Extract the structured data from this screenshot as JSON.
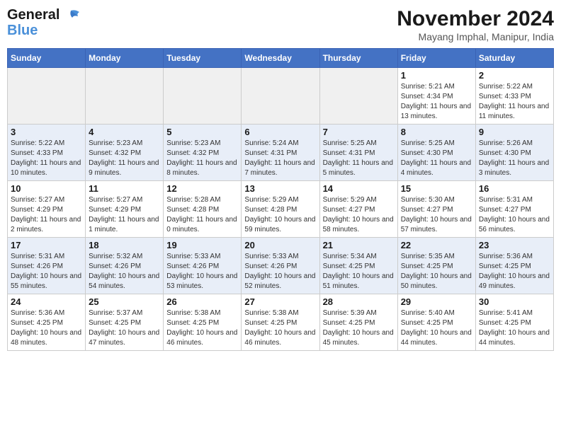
{
  "header": {
    "logo_line1": "General",
    "logo_line2": "Blue",
    "month_title": "November 2024",
    "location": "Mayang Imphal, Manipur, India"
  },
  "days_of_week": [
    "Sunday",
    "Monday",
    "Tuesday",
    "Wednesday",
    "Thursday",
    "Friday",
    "Saturday"
  ],
  "weeks": [
    [
      {
        "day": "",
        "info": ""
      },
      {
        "day": "",
        "info": ""
      },
      {
        "day": "",
        "info": ""
      },
      {
        "day": "",
        "info": ""
      },
      {
        "day": "",
        "info": ""
      },
      {
        "day": "1",
        "info": "Sunrise: 5:21 AM\nSunset: 4:34 PM\nDaylight: 11 hours and 13 minutes."
      },
      {
        "day": "2",
        "info": "Sunrise: 5:22 AM\nSunset: 4:33 PM\nDaylight: 11 hours and 11 minutes."
      }
    ],
    [
      {
        "day": "3",
        "info": "Sunrise: 5:22 AM\nSunset: 4:33 PM\nDaylight: 11 hours and 10 minutes."
      },
      {
        "day": "4",
        "info": "Sunrise: 5:23 AM\nSunset: 4:32 PM\nDaylight: 11 hours and 9 minutes."
      },
      {
        "day": "5",
        "info": "Sunrise: 5:23 AM\nSunset: 4:32 PM\nDaylight: 11 hours and 8 minutes."
      },
      {
        "day": "6",
        "info": "Sunrise: 5:24 AM\nSunset: 4:31 PM\nDaylight: 11 hours and 7 minutes."
      },
      {
        "day": "7",
        "info": "Sunrise: 5:25 AM\nSunset: 4:31 PM\nDaylight: 11 hours and 5 minutes."
      },
      {
        "day": "8",
        "info": "Sunrise: 5:25 AM\nSunset: 4:30 PM\nDaylight: 11 hours and 4 minutes."
      },
      {
        "day": "9",
        "info": "Sunrise: 5:26 AM\nSunset: 4:30 PM\nDaylight: 11 hours and 3 minutes."
      }
    ],
    [
      {
        "day": "10",
        "info": "Sunrise: 5:27 AM\nSunset: 4:29 PM\nDaylight: 11 hours and 2 minutes."
      },
      {
        "day": "11",
        "info": "Sunrise: 5:27 AM\nSunset: 4:29 PM\nDaylight: 11 hours and 1 minute."
      },
      {
        "day": "12",
        "info": "Sunrise: 5:28 AM\nSunset: 4:28 PM\nDaylight: 11 hours and 0 minutes."
      },
      {
        "day": "13",
        "info": "Sunrise: 5:29 AM\nSunset: 4:28 PM\nDaylight: 10 hours and 59 minutes."
      },
      {
        "day": "14",
        "info": "Sunrise: 5:29 AM\nSunset: 4:27 PM\nDaylight: 10 hours and 58 minutes."
      },
      {
        "day": "15",
        "info": "Sunrise: 5:30 AM\nSunset: 4:27 PM\nDaylight: 10 hours and 57 minutes."
      },
      {
        "day": "16",
        "info": "Sunrise: 5:31 AM\nSunset: 4:27 PM\nDaylight: 10 hours and 56 minutes."
      }
    ],
    [
      {
        "day": "17",
        "info": "Sunrise: 5:31 AM\nSunset: 4:26 PM\nDaylight: 10 hours and 55 minutes."
      },
      {
        "day": "18",
        "info": "Sunrise: 5:32 AM\nSunset: 4:26 PM\nDaylight: 10 hours and 54 minutes."
      },
      {
        "day": "19",
        "info": "Sunrise: 5:33 AM\nSunset: 4:26 PM\nDaylight: 10 hours and 53 minutes."
      },
      {
        "day": "20",
        "info": "Sunrise: 5:33 AM\nSunset: 4:26 PM\nDaylight: 10 hours and 52 minutes."
      },
      {
        "day": "21",
        "info": "Sunrise: 5:34 AM\nSunset: 4:25 PM\nDaylight: 10 hours and 51 minutes."
      },
      {
        "day": "22",
        "info": "Sunrise: 5:35 AM\nSunset: 4:25 PM\nDaylight: 10 hours and 50 minutes."
      },
      {
        "day": "23",
        "info": "Sunrise: 5:36 AM\nSunset: 4:25 PM\nDaylight: 10 hours and 49 minutes."
      }
    ],
    [
      {
        "day": "24",
        "info": "Sunrise: 5:36 AM\nSunset: 4:25 PM\nDaylight: 10 hours and 48 minutes."
      },
      {
        "day": "25",
        "info": "Sunrise: 5:37 AM\nSunset: 4:25 PM\nDaylight: 10 hours and 47 minutes."
      },
      {
        "day": "26",
        "info": "Sunrise: 5:38 AM\nSunset: 4:25 PM\nDaylight: 10 hours and 46 minutes."
      },
      {
        "day": "27",
        "info": "Sunrise: 5:38 AM\nSunset: 4:25 PM\nDaylight: 10 hours and 46 minutes."
      },
      {
        "day": "28",
        "info": "Sunrise: 5:39 AM\nSunset: 4:25 PM\nDaylight: 10 hours and 45 minutes."
      },
      {
        "day": "29",
        "info": "Sunrise: 5:40 AM\nSunset: 4:25 PM\nDaylight: 10 hours and 44 minutes."
      },
      {
        "day": "30",
        "info": "Sunrise: 5:41 AM\nSunset: 4:25 PM\nDaylight: 10 hours and 44 minutes."
      }
    ]
  ]
}
